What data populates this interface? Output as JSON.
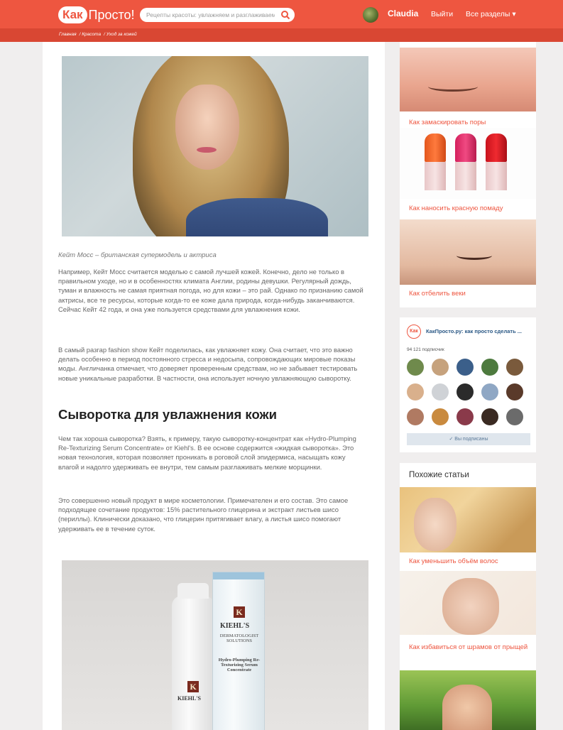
{
  "header": {
    "logo_badge": "Как",
    "logo_text": "Просто!",
    "search_placeholder": "Рецепты красоты: увлажняем и разглаживаем",
    "username": "Claudia",
    "logout": "Выйти",
    "all_sections": "Все разделы ▾"
  },
  "breadcrumb": [
    "Главная",
    "/ Красота",
    "/ Уход за кожей"
  ],
  "article": {
    "caption": "Кейт Мосс – британская супермодель и актриса",
    "p1": "Например, Кейт Мосс считается моделью с самой лучшей кожей. Конечно, дело не только в правильном уходе, но и в особенностях климата Англии, родины девушки. Регулярный дождь, туман и влажность не самая приятная погода, но для кожи – это рай. Однако по признанию самой актрисы, все те ресурсы, которые когда-то ее коже дала природа, когда-нибудь заканчиваются. Сейчас Кейт 42 года, и она уже пользуется средствами для увлажнения кожи.",
    "p2": "В самый разгар fashion show Кейт поделилась, как увлажняет кожу. Она считает, что это важно делать особенно в период постоянного стресса и недосыпа, сопровождающих мировые показы моды. Англичанка отмечает, что доверяет проверенным средствам, но не забывает тестировать новые уникальные разработки. В частности, она использует ночную увлажняющую сыворотку.",
    "heading": "Сыворотка для увлажнения кожи",
    "p3": "Чем так хороша сыворотка? Взять, к примеру, такую сыворотку-концентрат как «Hydro-Plumping Re-Texturizing Serum Concentrate» от Kiehl's. В ее основе содержится «жидкая сыворотка». Это новая технология, которая позволяет проникать в роговой слой эпидермиса, насыщать кожу влагой и надолго удерживать ее внутри, тем самым разглаживать мелкие морщинки.",
    "p4": "Это совершенно новый продукт в мире косметологии. Примечателен и его состав. Это самое подходящее сочетание продуктов: 15% растительного глицерина и экстракт листьев шисо (периллы). Клинически доказано, что глицерин притягивает влагу, а листья шисо помогают удерживать ее в течение суток.",
    "product": {
      "brand_k": "K",
      "brand_name": "KIEHL'S",
      "box_line1": "DERMATOLOGIST SOLUTIONS",
      "box_line2": "Hydro-Plumping Re-Texturizing Serum Concentrate"
    }
  },
  "sidebar": {
    "links": [
      "Как замаскировать поры",
      "Как наносить красную помаду",
      "Как отбелить веки"
    ],
    "vk": {
      "logo": "Как",
      "title": "КакПросто.ру: как просто сделать ...",
      "count": "94 121 подписчик",
      "button": "✓ Вы подписаны"
    },
    "similar": {
      "title": "Похожие статьи",
      "links": [
        "Как уменьшить объём волос",
        "Как избавиться от шрамов от прыщей"
      ]
    }
  },
  "colors": {
    "brand": "#ee5640",
    "breadcrumb_bar": "#d94733",
    "link": "#ee5640"
  },
  "icons": {
    "search": "search-icon",
    "checkmark": "check-icon"
  }
}
